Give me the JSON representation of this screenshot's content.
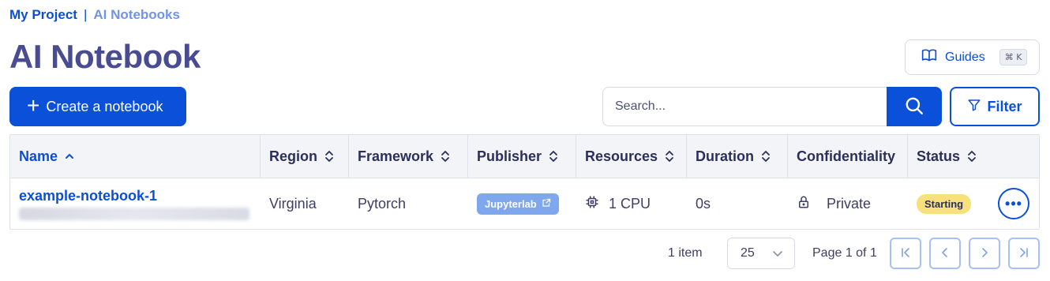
{
  "breadcrumb": {
    "root": "My Project",
    "separator": "|",
    "current": "AI Notebooks"
  },
  "page_title": "AI Notebook",
  "guides": {
    "label": "Guides",
    "shortcut": "⌘ K"
  },
  "toolbar": {
    "create_label": "Create a notebook",
    "search_placeholder": "Search...",
    "filter_label": "Filter"
  },
  "table": {
    "columns": {
      "name": "Name",
      "region": "Region",
      "framework": "Framework",
      "publisher": "Publisher",
      "resources": "Resources",
      "duration": "Duration",
      "confidentiality": "Confidentiality",
      "status": "Status"
    },
    "rows": [
      {
        "name": "example-notebook-1",
        "region": "Virginia",
        "framework": "Pytorch",
        "publisher": "Jupyterlab",
        "resources": "1 CPU",
        "duration": "0s",
        "confidentiality": "Private",
        "status": "Starting",
        "status_color": "#f8e17c"
      }
    ]
  },
  "pagination": {
    "item_count": "1 item",
    "page_size": "25",
    "page_label": "Page 1 of 1"
  },
  "colors": {
    "primary": "#0b50d8",
    "title": "#4a4c93",
    "status_starting": "#f8e17c",
    "publisher_badge": "#7fa7ee"
  }
}
